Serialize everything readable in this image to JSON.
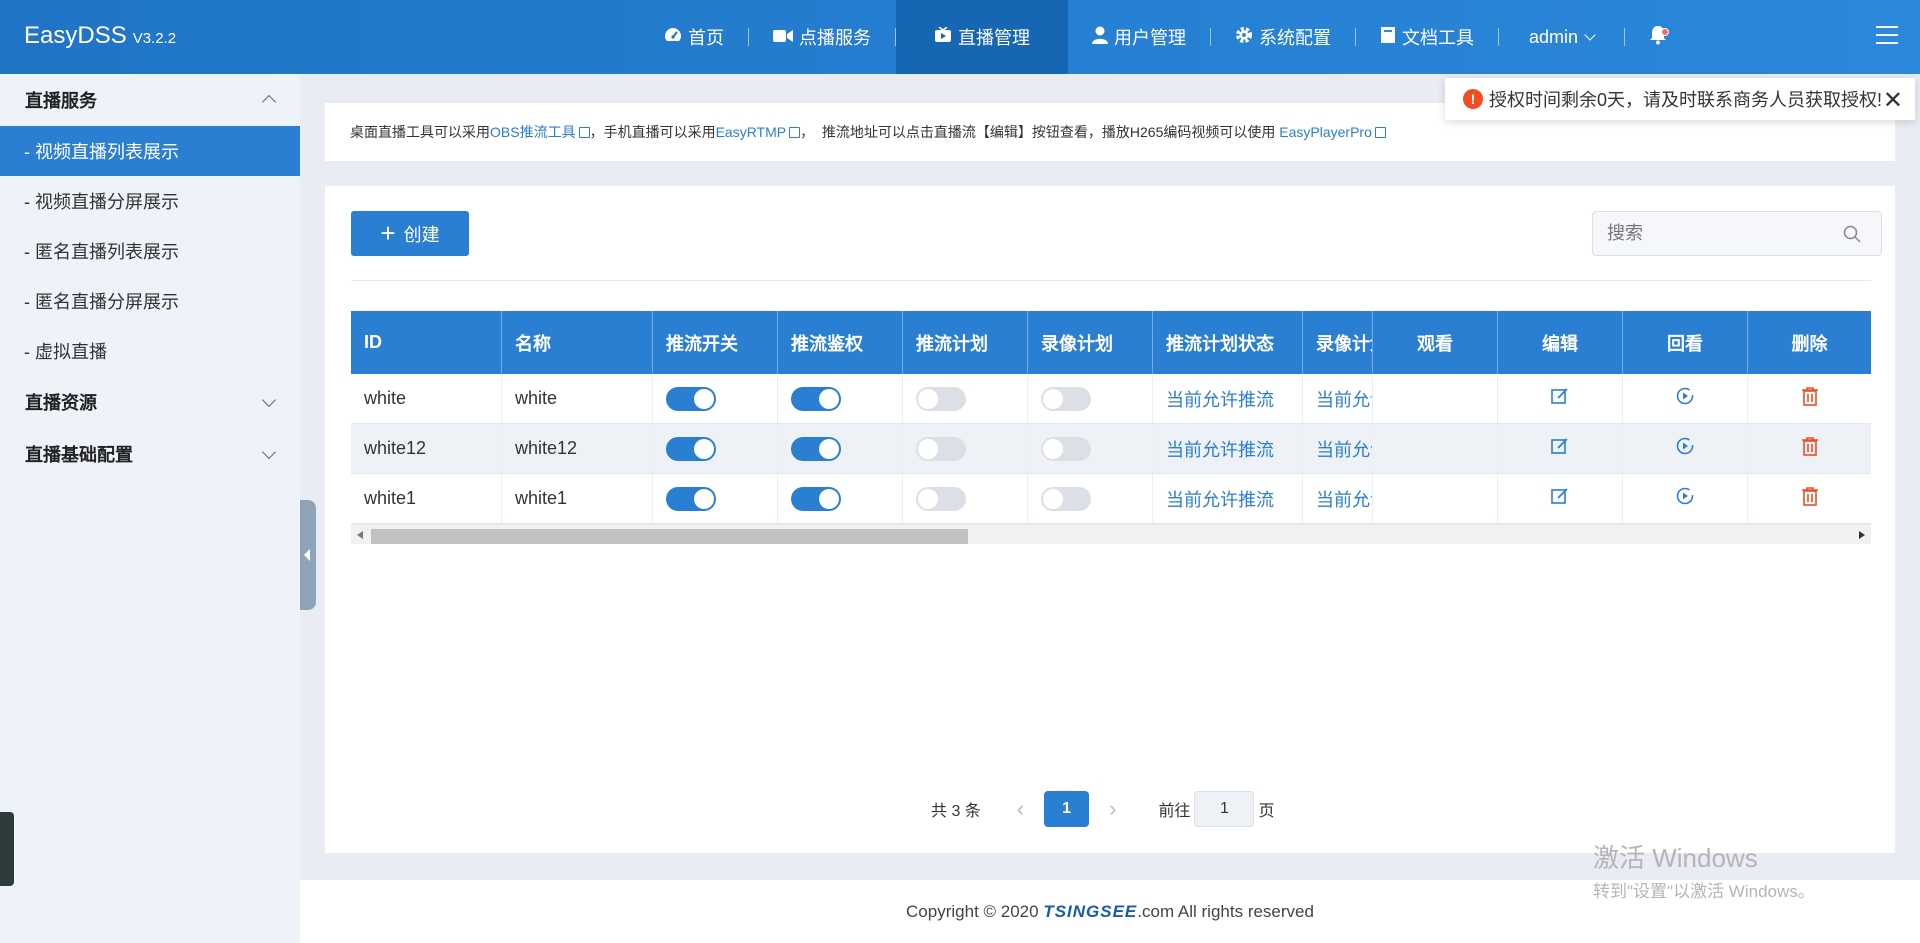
{
  "app": {
    "name": "EasyDSS",
    "version": "V3.2.2"
  },
  "nav": {
    "items": [
      {
        "label": "首页",
        "icon": "dashboard-icon"
      },
      {
        "label": "点播服务",
        "icon": "video-camera-icon"
      },
      {
        "label": "直播管理",
        "icon": "live-tv-icon",
        "active": true
      },
      {
        "label": "用户管理",
        "icon": "user-icon"
      },
      {
        "label": "系统配置",
        "icon": "gear-icon"
      },
      {
        "label": "文档工具",
        "icon": "document-icon"
      }
    ],
    "user": "admin"
  },
  "sidebar": {
    "group1": "直播服务",
    "items": [
      "- 视频直播列表展示",
      "- 视频直播分屏展示",
      "- 匿名直播列表展示",
      "- 匿名直播分屏展示",
      "- 虚拟直播"
    ],
    "group2": "直播资源",
    "group3": "直播基础配置"
  },
  "notice": {
    "t1": "桌面直播工具可以采用 ",
    "l1": "OBS推流工具",
    "t2": "，手机直播可以采用 ",
    "l2": "EasyRTMP",
    "t3": "，  推流地址可以点击直播流【编辑】按钮查看，播放H265编码视频可以使用 ",
    "l3": "EasyPlayerPro"
  },
  "toast": {
    "message": "授权时间剩余0天，请及时联系商务人员获取授权!"
  },
  "toolbar": {
    "create": "创建",
    "search_placeholder": "搜索"
  },
  "table": {
    "headers": {
      "id": "ID",
      "name": "名称",
      "push_switch": "推流开关",
      "push_auth": "推流鉴权",
      "push_plan": "推流计划",
      "record_plan": "录像计划",
      "push_plan_status": "推流计划状态",
      "record_plan_status": "录像计划",
      "watch": "观看",
      "edit": "编辑",
      "replay": "回看",
      "delete": "删除"
    },
    "rows": [
      {
        "id": "white",
        "name": "white",
        "push_switch": true,
        "push_auth": true,
        "push_plan": false,
        "record_plan": false,
        "push_status": "当前允许推流",
        "record_status": "当前允许"
      },
      {
        "id": "white12",
        "name": "white12",
        "push_switch": true,
        "push_auth": true,
        "push_plan": false,
        "record_plan": false,
        "push_status": "当前允许推流",
        "record_status": "当前允许"
      },
      {
        "id": "white1",
        "name": "white1",
        "push_switch": true,
        "push_auth": true,
        "push_plan": false,
        "record_plan": false,
        "push_status": "当前允许推流",
        "record_status": "当前允许"
      }
    ]
  },
  "pagination": {
    "total": "共 3 条",
    "current": "1",
    "goto_prefix": "前往",
    "goto_value": "1",
    "goto_suffix": "页"
  },
  "footer": {
    "pre": "Copyright © 2020 ",
    "brand": "TSINGSEE",
    "post": ".com All rights reserved"
  },
  "watermark": {
    "line1": "激活 Windows",
    "line2": "转到\"设置\"以激活 Windows。"
  },
  "colors": {
    "primary": "#2b7fd3",
    "danger": "#f04d22",
    "topbar": "#1f74c6"
  }
}
